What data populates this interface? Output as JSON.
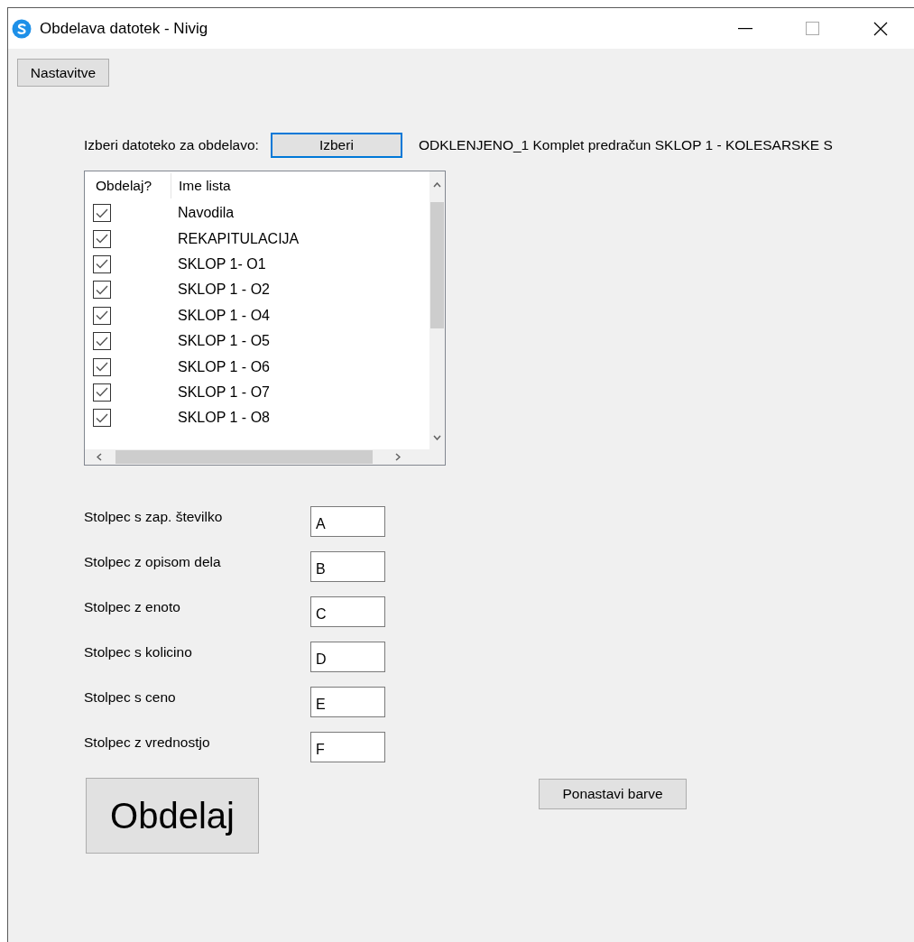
{
  "window": {
    "title": "Obdelava datotek - Nivig"
  },
  "settings_button": "Nastavitve",
  "file_picker": {
    "label": "Izberi datoteko za obdelavo:",
    "button": "Izberi",
    "file_name": "ODKLENJENO_1 Komplet predračun SKLOP 1 - KOLESARSKE S"
  },
  "sheets": {
    "columns": [
      "Obdelaj?",
      "Ime lista"
    ],
    "rows": [
      {
        "checked": true,
        "name": "Navodila"
      },
      {
        "checked": true,
        "name": "REKAPITULACIJA"
      },
      {
        "checked": true,
        "name": "SKLOP 1- O1"
      },
      {
        "checked": true,
        "name": "SKLOP 1 - O2"
      },
      {
        "checked": true,
        "name": "SKLOP 1 - O4"
      },
      {
        "checked": true,
        "name": "SKLOP 1 - O5"
      },
      {
        "checked": true,
        "name": "SKLOP 1 - O6"
      },
      {
        "checked": true,
        "name": "SKLOP 1 - O7"
      },
      {
        "checked": true,
        "name": "SKLOP 1 - O8"
      }
    ]
  },
  "columns": [
    {
      "label": "Stolpec s zap. številko",
      "value": "A"
    },
    {
      "label": "Stolpec z opisom dela",
      "value": "B"
    },
    {
      "label": "Stolpec z enoto",
      "value": "C"
    },
    {
      "label": "Stolpec s kolicino",
      "value": "D"
    },
    {
      "label": "Stolpec s ceno",
      "value": "E"
    },
    {
      "label": "Stolpec z vrednostjo",
      "value": "F"
    }
  ],
  "process_button": "Obdelaj",
  "reset_colors_button": "Ponastavi barve"
}
